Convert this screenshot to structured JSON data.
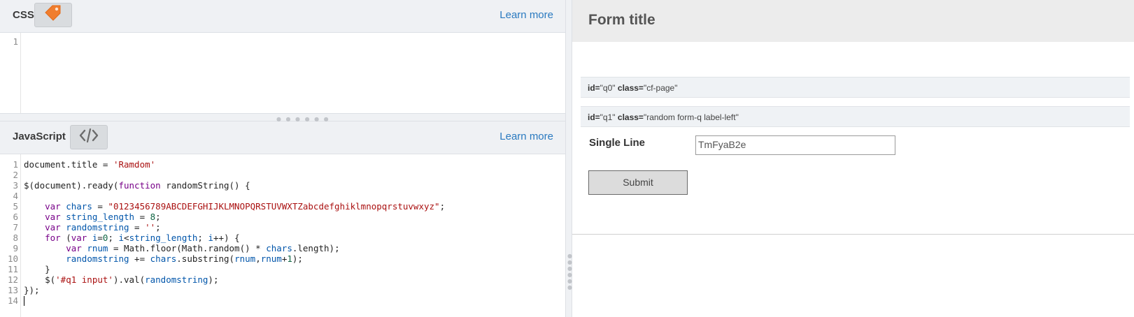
{
  "css_panel": {
    "title": "CSS",
    "icon": "tag-icon",
    "learn_more": "Learn more",
    "line_numbers": [
      "1"
    ]
  },
  "js_panel": {
    "title": "JavaScript",
    "icon": "code-brackets-icon",
    "learn_more": "Learn more",
    "line_numbers": [
      "1",
      "2",
      "3",
      "4",
      "5",
      "6",
      "7",
      "8",
      "9",
      "10",
      "11",
      "12",
      "13",
      "14"
    ]
  },
  "code_lines": [
    "document.title = 'Ramdom'",
    "",
    "$(document).ready(function randomString() {",
    "",
    "    var chars = \"0123456789ABCDEFGHIJKLMNOPQRSTUVWXTZabcdefghiklmnopqrstuvwxyz\";",
    "    var string_length = 8;",
    "    var randomstring = '';",
    "    for (var i=0; i<string_length; i++) {",
    "        var rnum = Math.floor(Math.random() * chars.length);",
    "        randomstring += chars.substring(rnum,rnum+1);",
    "    }",
    "    $('#q1 input').val(randomstring);",
    "});",
    ""
  ],
  "preview": {
    "form_title": "Form title",
    "page_info": {
      "id_label": "id=",
      "id_value": "\"q0\"",
      "class_label": "class=",
      "class_value": "\"cf-page\""
    },
    "question_info": {
      "id_label": "id=",
      "id_value": "\"q1\"",
      "class_label": "class=",
      "class_value": "\"random form-q label-left\""
    },
    "field_label": "Single Line",
    "field_value": "TmFyaB2e",
    "submit_label": "Submit"
  },
  "colors": {
    "accent_link": "#2a7ac0",
    "tag_icon": "#f07d2e",
    "keyword": "#770088",
    "variable": "#0055aa",
    "string": "#aa1111",
    "number": "#116644"
  }
}
